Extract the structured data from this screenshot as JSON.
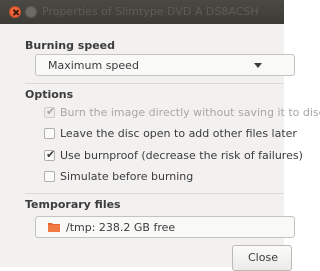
{
  "window": {
    "title": "Properties of Slimtype DVD A  DS8ACSH"
  },
  "burning_speed": {
    "heading": "Burning speed",
    "selected": "Maximum speed"
  },
  "options": {
    "heading": "Options",
    "items": [
      {
        "label": "Burn the image directly without saving it to disc",
        "checked": true,
        "enabled": false
      },
      {
        "label": "Leave the disc open to add other files later",
        "checked": false,
        "enabled": true
      },
      {
        "label": "Use burnproof (decrease the risk of failures)",
        "checked": true,
        "enabled": true
      },
      {
        "label": "Simulate before burning",
        "checked": false,
        "enabled": true
      }
    ]
  },
  "temporary_files": {
    "heading": "Temporary files",
    "path": "/tmp: 238.2 GB free"
  },
  "buttons": {
    "close": "Close"
  },
  "colors": {
    "titlebar": "#3c3b37",
    "close_dot": "#f0673b",
    "folder": "#e8622c",
    "background": "#f2f1f0"
  }
}
